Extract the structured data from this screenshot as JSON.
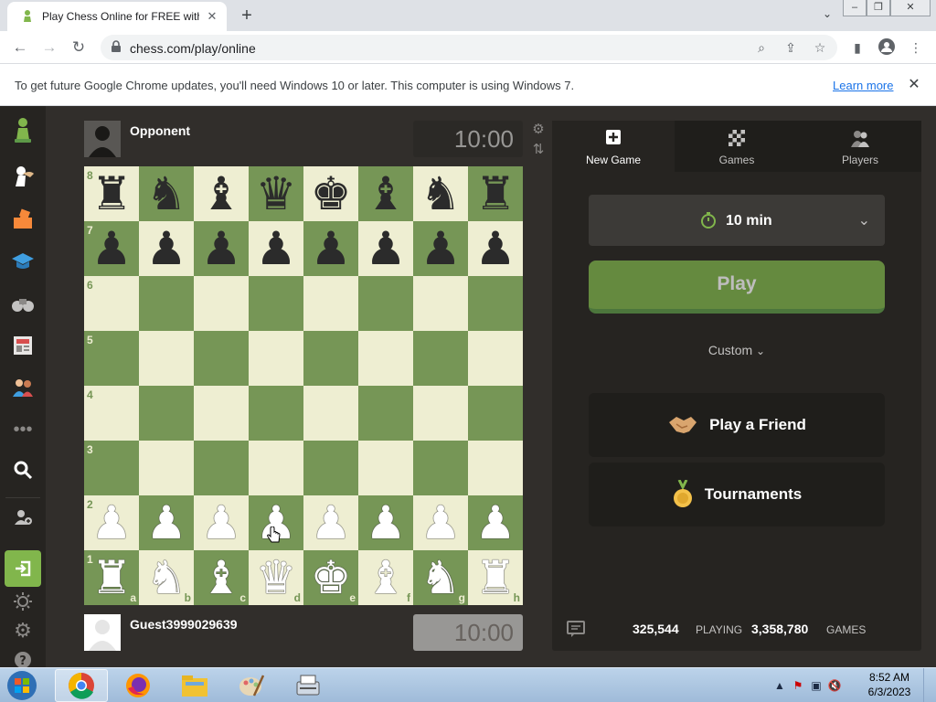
{
  "browser": {
    "tab_title": "Play Chess Online for FREE with F",
    "url": "chess.com/play/online",
    "infobar_text": "To get future Google Chrome updates, you'll need Windows 10 or later. This computer is using Windows 7.",
    "infobar_link": "Learn more"
  },
  "sidebar": {
    "items": [
      "logo-pawn",
      "play",
      "puzzles",
      "learn",
      "watch",
      "news",
      "social",
      "more",
      "search",
      "sign-up",
      "log-in",
      "light-mode",
      "settings",
      "help"
    ]
  },
  "game": {
    "opponent_name": "Opponent",
    "opponent_clock": "10:00",
    "player_name": "Guest3999029639",
    "player_clock": "10:00"
  },
  "board": {
    "ranks": [
      "8",
      "7",
      "6",
      "5",
      "4",
      "3",
      "2",
      "1"
    ],
    "files": [
      "a",
      "b",
      "c",
      "d",
      "e",
      "f",
      "g",
      "h"
    ],
    "rows": [
      [
        "br",
        "bn",
        "bb",
        "bq",
        "bk",
        "bb",
        "bn",
        "br"
      ],
      [
        "bp",
        "bp",
        "bp",
        "bp",
        "bp",
        "bp",
        "bp",
        "bp"
      ],
      [
        "",
        "",
        "",
        "",
        "",
        "",
        "",
        ""
      ],
      [
        "",
        "",
        "",
        "",
        "",
        "",
        "",
        ""
      ],
      [
        "",
        "",
        "",
        "",
        "",
        "",
        "",
        ""
      ],
      [
        "",
        "",
        "",
        "",
        "",
        "",
        "",
        ""
      ],
      [
        "wp",
        "wp",
        "wp",
        "wp",
        "wp",
        "wp",
        "wp",
        "wp"
      ],
      [
        "wr",
        "wn",
        "wb",
        "wq",
        "wk",
        "wb",
        "wn",
        "wr"
      ]
    ],
    "light_color": "#eeeed2",
    "dark_color": "#769656"
  },
  "panel": {
    "tabs": [
      {
        "label": "New Game"
      },
      {
        "label": "Games"
      },
      {
        "label": "Players"
      }
    ],
    "time_control": "10 min",
    "play_label": "Play",
    "custom_label": "Custom",
    "friend_label": "Play a Friend",
    "tournaments_label": "Tournaments",
    "playing_count": "325,544",
    "playing_label": "PLAYING",
    "games_count": "3,358,780",
    "games_label": "GAMES"
  },
  "taskbar": {
    "time": "8:52 AM",
    "date": "6/3/2023"
  },
  "colors": {
    "accent_green": "#81b64c",
    "panel_bg": "#262421",
    "page_bg": "#312e2b"
  }
}
